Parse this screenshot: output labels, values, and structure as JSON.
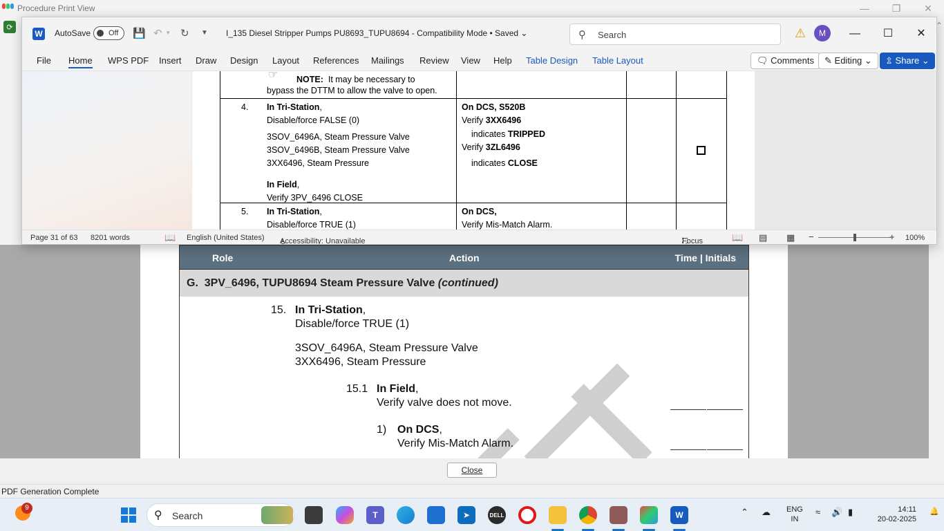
{
  "background_window": {
    "title": "Procedure Print View",
    "header": {
      "role": "Role",
      "action": "Action",
      "time": "Time | Initials"
    },
    "section": {
      "prefix": "G.",
      "title": "3PV_6496, TUPU8694 Steam Pressure Valve",
      "suffix": "(continued)"
    },
    "steps": {
      "s15_num": "15.",
      "s15_loc": "In Tri-Station",
      "s15_comma": ",",
      "s15_action": "Disable/force TRUE (1)",
      "s15_item1": "3SOV_6496A, Steam Pressure Valve",
      "s15_item2": "3XX6496, Steam Pressure",
      "s151_num": "15.1",
      "s151_loc": "In Field",
      "s151_comma": ",",
      "s151_action": "Verify valve does not move.",
      "s1_num": "1)",
      "s1_loc": "On DCS",
      "s1_comma": ",",
      "s1_action": "Verify Mis-Match Alarm."
    },
    "close_button": "Close",
    "status": "PDF Generation Complete"
  },
  "word": {
    "autosave_label": "AutoSave",
    "autosave_state": "Off",
    "doc_title": "I_135 Diesel Stripper Pumps PU8693_TUPU8694  -  Compatibility Mode • Saved",
    "search_placeholder": "Search",
    "avatar_initial": "M",
    "tabs": [
      "File",
      "Home",
      "WPS PDF",
      "Insert",
      "Draw",
      "Design",
      "Layout",
      "References",
      "Mailings",
      "Review",
      "View",
      "Help",
      "Table Design",
      "Table Layout"
    ],
    "comments_label": "Comments",
    "editing_label": "Editing",
    "share_label": "Share",
    "doc": {
      "note_label": "NOTE:",
      "note_line1": "It may be necessary to",
      "note_line2": "bypass the DTTM to allow the valve to open.",
      "row4": {
        "num": "4.",
        "loc": "In Tri-Station",
        "action": "Disable/force FALSE (0)",
        "item1": "3SOV_6496A, Steam Pressure Valve",
        "item2": "3SOV_6496B, Steam Pressure Valve",
        "item3": "3XX6496, Steam Pressure",
        "field_loc": "In Field",
        "field_action": "Verify 3PV_6496 CLOSE",
        "dcs_header": "On DCS, S520B",
        "verify1_prefix": "Verify ",
        "verify1_tag": "3XX6496",
        "indicates1_prefix": "indicates ",
        "indicates1_value": "TRIPPED",
        "verify2_prefix": "Verify ",
        "verify2_tag": "3ZL6496",
        "indicates2_prefix": "indicates ",
        "indicates2_value": "CLOSE"
      },
      "row5": {
        "num": "5.",
        "loc": "In Tri-Station",
        "action": "Disable/force TRUE (1)",
        "dcs_header": "On DCS,",
        "dcs_action": "Verify Mis-Match Alarm."
      }
    },
    "status": {
      "page": "Page 31 of 63",
      "words": "8201 words",
      "language": "English (United States)",
      "accessibility": "Accessibility: Unavailable",
      "focus": "Focus",
      "zoom": "100%",
      "zoom_level": 1.0
    }
  },
  "taskbar": {
    "weather_badge": "9",
    "search_label": "Search",
    "lang_line1": "ENG",
    "lang_line2": "IN",
    "time": "14:11",
    "date": "20-02-2025",
    "apps": [
      "widgets-icon",
      "file-explorer-icon",
      "copilot-icon",
      "teams-icon",
      "edge-icon",
      "store-icon",
      "power-automate-icon",
      "dell-icon",
      "opera-icon",
      "folder-icon",
      "chrome-icon",
      "photo-app-icon",
      "sync-app-icon",
      "word-icon"
    ],
    "colors": {
      "accent": "#185abd",
      "start": "#1479d8"
    }
  }
}
